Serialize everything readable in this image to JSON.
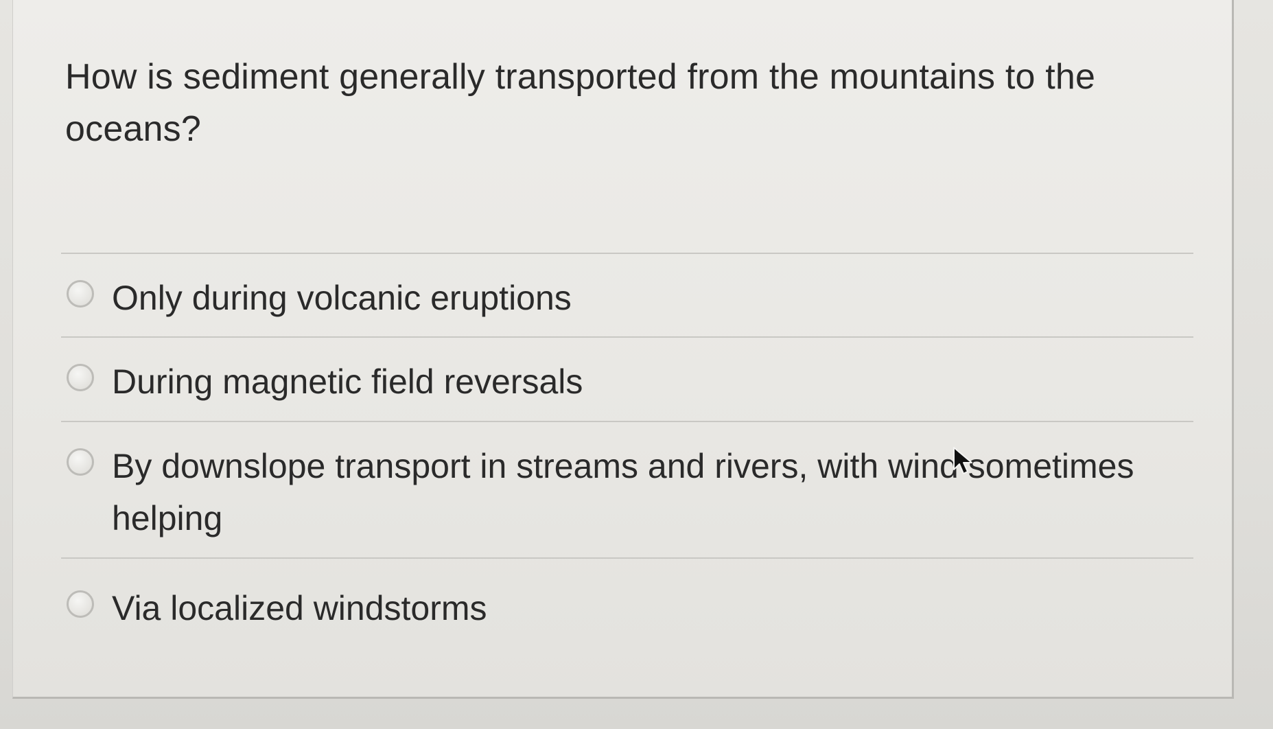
{
  "question": {
    "text": "How is sediment generally transported from the mountains to the oceans?"
  },
  "options": [
    {
      "label": "Only during volcanic eruptions",
      "selected": false
    },
    {
      "label": "During magnetic field reversals",
      "selected": false
    },
    {
      "label": "By downslope transport in streams and rivers, with wind sometimes helping",
      "selected": false
    },
    {
      "label": "Via localized windstorms",
      "selected": false
    }
  ],
  "icons": {
    "radio": "radio-unchecked-icon",
    "cursor": "mouse-pointer-icon"
  }
}
